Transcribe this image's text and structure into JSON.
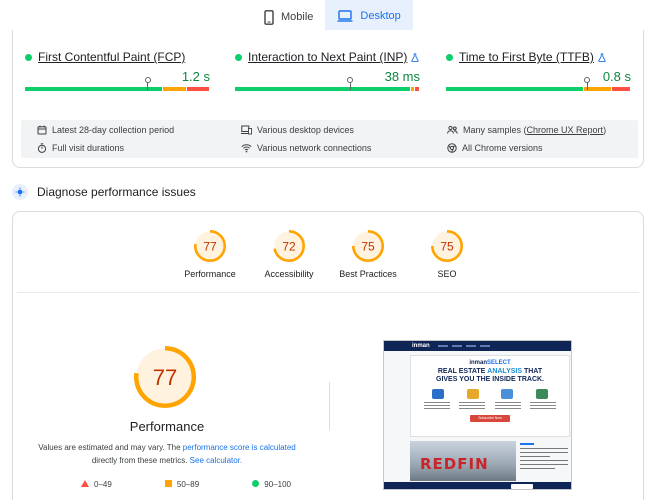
{
  "tabs": [
    {
      "label": "Mobile",
      "active": false
    },
    {
      "label": "Desktop",
      "active": true
    }
  ],
  "metrics": [
    {
      "name": "First Contentful Paint (FCP)",
      "value": "1.2 s",
      "experimental": false,
      "good": 0.75,
      "ni": 0.13,
      "poor": 0.12,
      "marker": 0.66
    },
    {
      "name": "Interaction to Next Paint (INP)",
      "value": "38 ms",
      "experimental": true,
      "good": 0.96,
      "ni": 0.02,
      "poor": 0.02,
      "marker": 0.62
    },
    {
      "name": "Time to First Byte (TTFB)",
      "value": "0.8 s",
      "experimental": true,
      "good": 0.75,
      "ni": 0.15,
      "poor": 0.1,
      "marker": 0.76
    }
  ],
  "info": {
    "collection": "Latest 28-day collection period",
    "durations": "Full visit durations",
    "devices": "Various desktop devices",
    "network": "Various network connections",
    "samples_prefix": "Many samples (",
    "samples_link": "Chrome UX Report",
    "samples_suffix": ")",
    "chrome": "All Chrome versions"
  },
  "diagnose": {
    "title": "Diagnose performance issues"
  },
  "scores": [
    {
      "label": "Performance",
      "value": 77
    },
    {
      "label": "Accessibility",
      "value": 72
    },
    {
      "label": "Best Practices",
      "value": 75
    },
    {
      "label": "SEO",
      "value": 75
    }
  ],
  "main_score": {
    "label": "Performance",
    "value": 77
  },
  "note": {
    "text1": "Values are estimated and may vary. The ",
    "link1": "performance score is calculated",
    "text2": " directly from these metrics. ",
    "link2": "See calculator."
  },
  "legend": [
    {
      "range": "0–49",
      "color": "#ff4e42"
    },
    {
      "range": "50–89",
      "color": "#ffa400"
    },
    {
      "range": "90–100",
      "color": "#0cce6b"
    }
  ],
  "thumbnail": {
    "brand": "inman",
    "logo_a": "inman",
    "logo_b": "SELECT",
    "headline_a": "REAL ESTATE ",
    "headline_b": "ANALYSIS",
    "headline_c": " THAT",
    "headline_line2": "GIVES YOU THE INSIDE TRACK.",
    "cta": "Subscribe Now",
    "photo_text": "REDFIN"
  },
  "colors": {
    "good": "#0cce6b",
    "average": "#ffa400",
    "poor": "#ff4e42",
    "accent": "#1a73e8",
    "score_text": "#c33300"
  }
}
